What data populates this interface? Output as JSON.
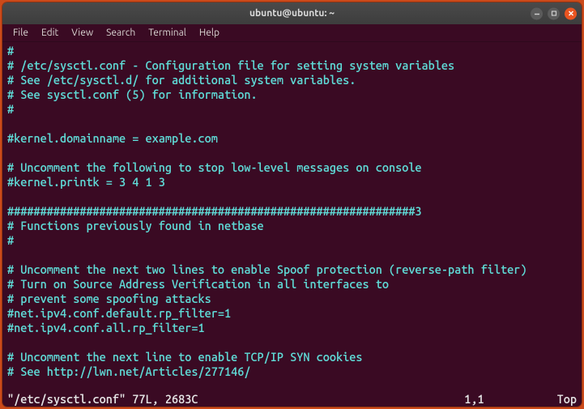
{
  "titlebar": {
    "title": "ubuntu@ubuntu: ~"
  },
  "menubar": {
    "items": [
      {
        "label": "File"
      },
      {
        "label": "Edit"
      },
      {
        "label": "View"
      },
      {
        "label": "Search"
      },
      {
        "label": "Terminal"
      },
      {
        "label": "Help"
      }
    ]
  },
  "terminal": {
    "lines": [
      "#",
      "# /etc/sysctl.conf - Configuration file for setting system variables",
      "# See /etc/sysctl.d/ for additional system variables.",
      "# See sysctl.conf (5) for information.",
      "#",
      "",
      "#kernel.domainname = example.com",
      "",
      "# Uncomment the following to stop low-level messages on console",
      "#kernel.printk = 3 4 1 3",
      "",
      "##############################################################3",
      "# Functions previously found in netbase",
      "#",
      "",
      "# Uncomment the next two lines to enable Spoof protection (reverse-path filter)",
      "# Turn on Source Address Verification in all interfaces to",
      "# prevent some spoofing attacks",
      "#net.ipv4.conf.default.rp_filter=1",
      "#net.ipv4.conf.all.rp_filter=1",
      "",
      "# Uncomment the next line to enable TCP/IP SYN cookies",
      "# See http://lwn.net/Articles/277146/"
    ]
  },
  "statusbar": {
    "file_info": "\"/etc/sysctl.conf\" 77L, 2683C",
    "position": "1,1",
    "scroll": "Top"
  }
}
